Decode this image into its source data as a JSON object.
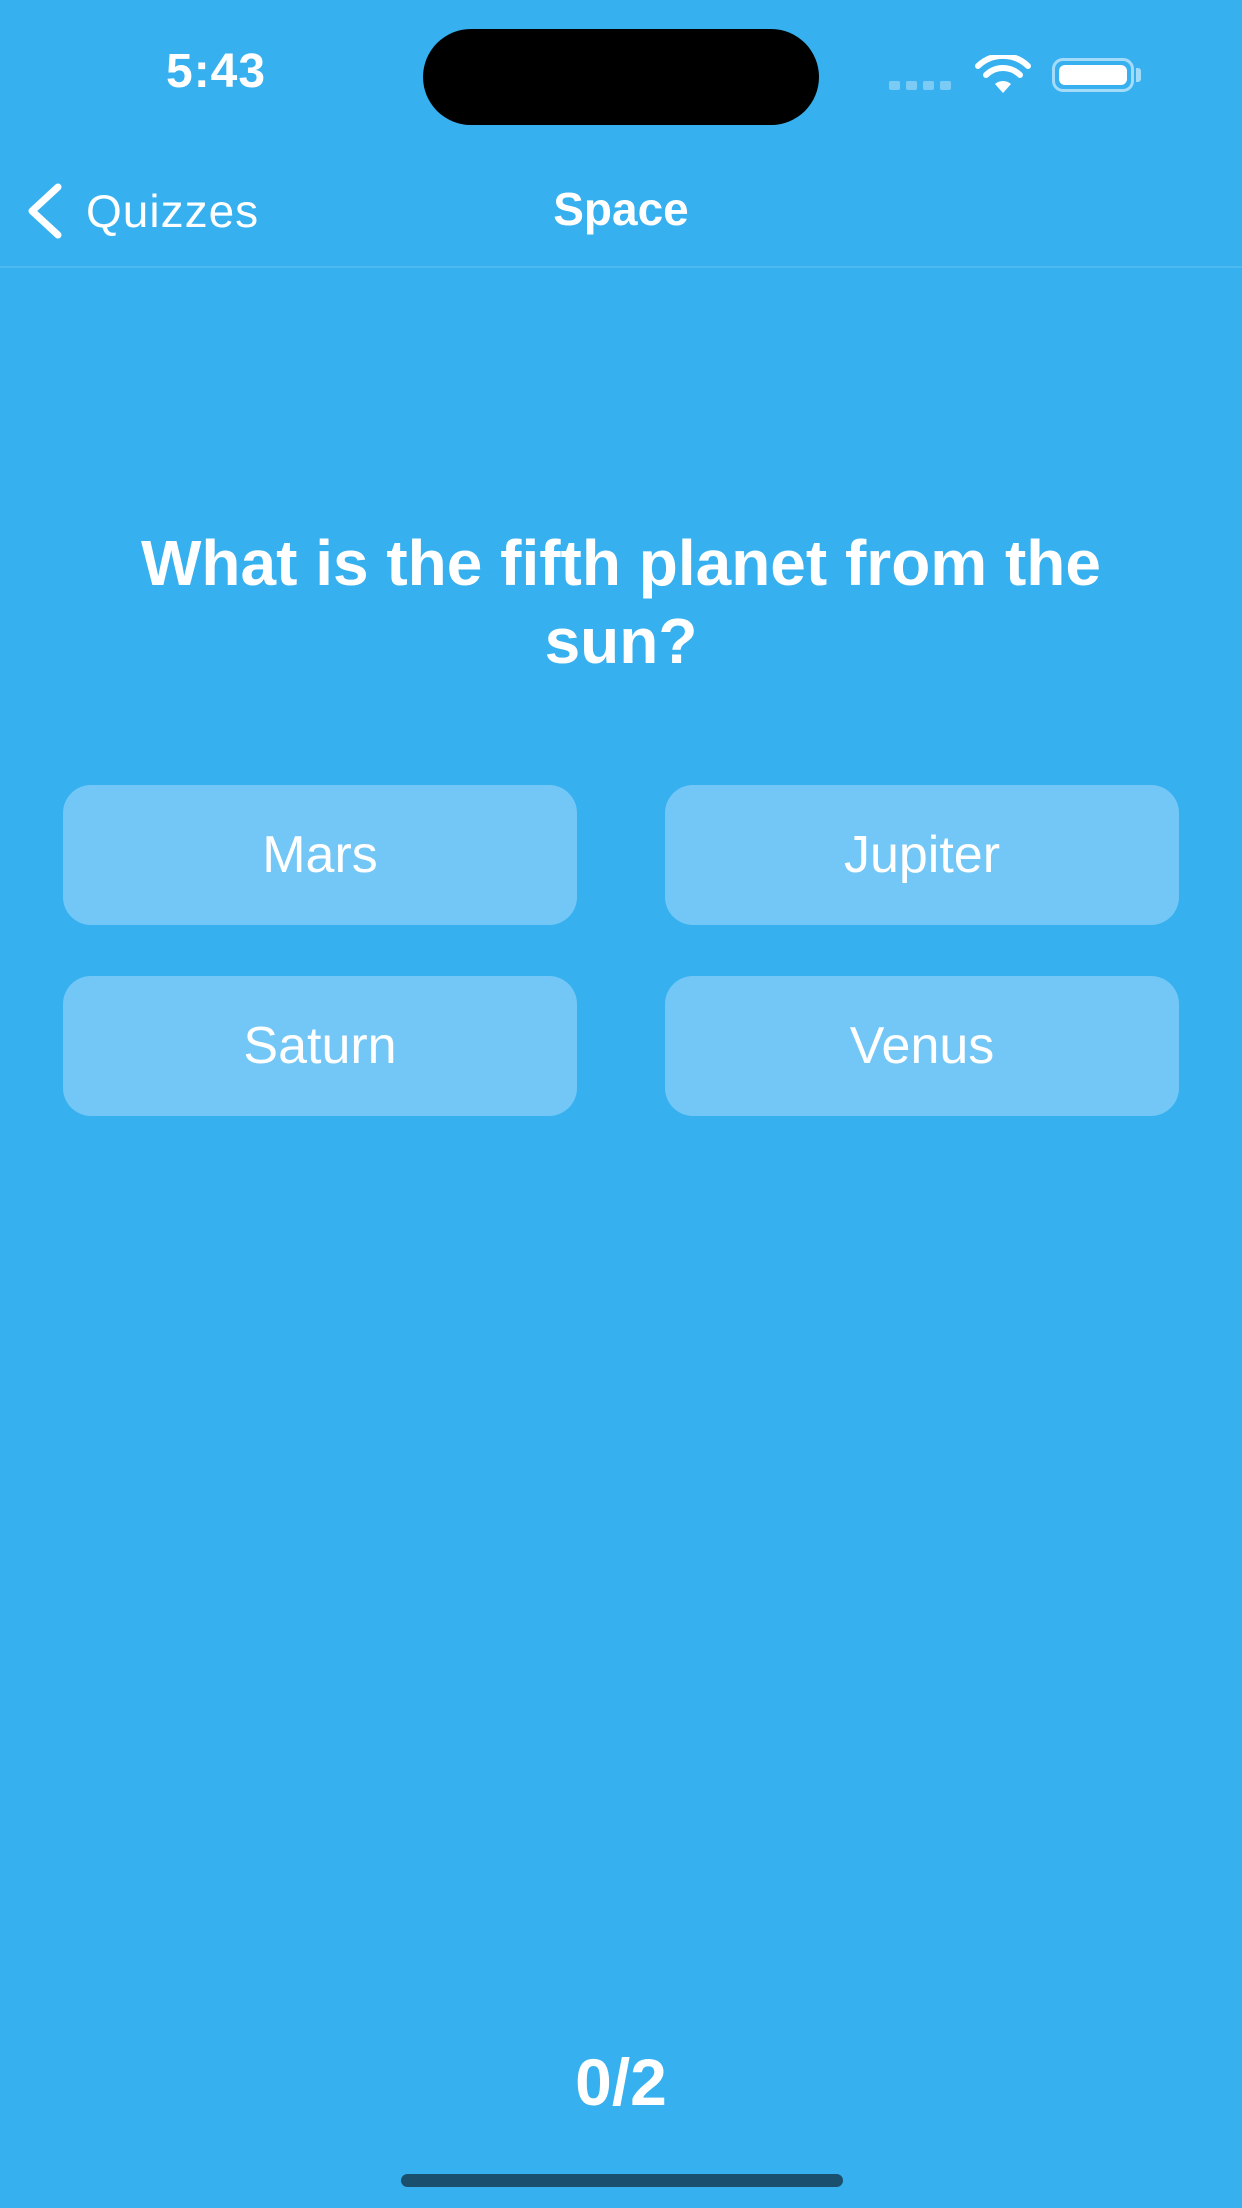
{
  "status_bar": {
    "time": "5:43",
    "icons": [
      "cellular-signal-icon",
      "wifi-icon",
      "battery-icon"
    ]
  },
  "nav": {
    "back_label": "Quizzes",
    "back_icon": "chevron-left-icon",
    "title": "Space"
  },
  "quiz": {
    "question": "What is the fifth planet from the sun?",
    "answers": [
      {
        "label": "Mars"
      },
      {
        "label": "Jupiter"
      },
      {
        "label": "Saturn"
      },
      {
        "label": "Venus"
      }
    ],
    "score": "0/2"
  },
  "colors": {
    "background": "#36b0ef",
    "answer_button": "#73c7f6",
    "text": "#ffffff"
  }
}
